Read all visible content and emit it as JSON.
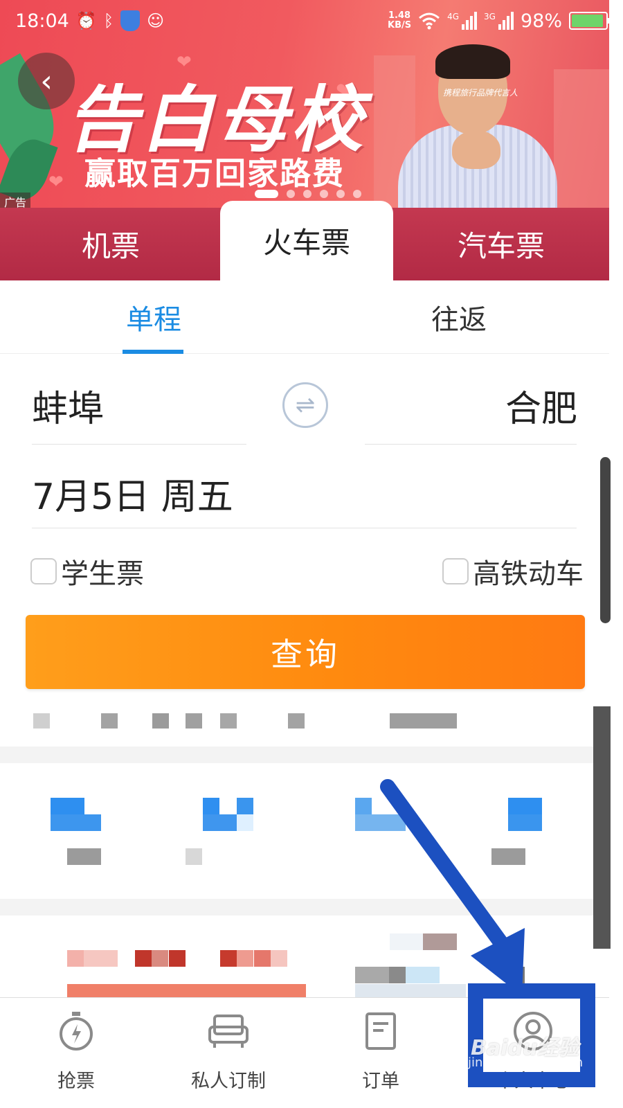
{
  "status_bar": {
    "time": "18:04",
    "net_speed_value": "1.48",
    "net_speed_unit": "KB/S",
    "signal_1": "4G",
    "signal_2": "3G",
    "battery": "98%"
  },
  "banner": {
    "headline": "告白母校",
    "subline": "赢取百万回家路费",
    "endorser_caption": "携程旅行品牌代言人",
    "ad_badge": "广告",
    "page_count": 6,
    "active_page": 0
  },
  "mode_tabs": [
    {
      "label": "机票",
      "active": false
    },
    {
      "label": "火车票",
      "active": true
    },
    {
      "label": "汽车票",
      "active": false
    }
  ],
  "trip_tabs": {
    "one_way": "单程",
    "round_trip": "往返",
    "active": "one_way"
  },
  "form": {
    "from_city": "蚌埠",
    "to_city": "合肥",
    "date": "7月5日 周五",
    "student_ticket": "学生票",
    "high_speed": "高铁动车",
    "search_button": "查询"
  },
  "bottom_nav": [
    {
      "label": "抢票",
      "icon": "stopwatch-icon"
    },
    {
      "label": "私人订制",
      "icon": "sofa-icon"
    },
    {
      "label": "订单",
      "icon": "document-icon"
    },
    {
      "label": "个人中心",
      "icon": "user-icon"
    }
  ],
  "watermark": {
    "brand": "Baidu经验",
    "url": "jingyan.baidu.com"
  },
  "colors": {
    "accent_blue": "#1b8ce3",
    "search_orange": "#ff8a0f",
    "banner_red": "#ee4a55",
    "annotation_blue": "#1c50c0"
  }
}
